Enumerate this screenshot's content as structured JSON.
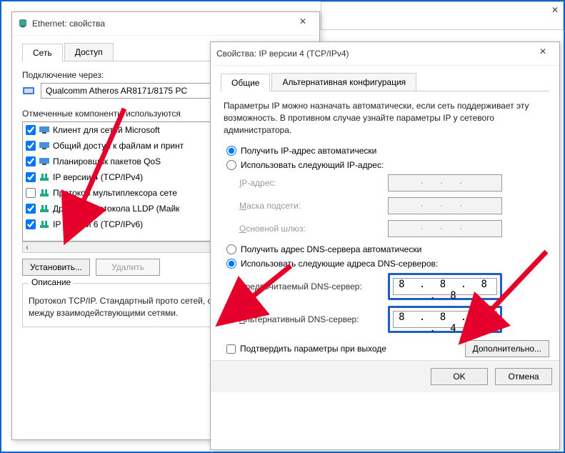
{
  "bg_parent": {
    "close": "✕"
  },
  "ethernet": {
    "title": "Ethernet: свойства",
    "close": "✕",
    "tabs": {
      "network": "Сеть",
      "access": "Доступ"
    },
    "connect_via_label": "Подключение через:",
    "adapter_name": "Qualcomm Atheros AR8171/8175 PC",
    "components_label": "Отмеченные компоненты используются",
    "components": [
      {
        "checked": true,
        "label": "Клиент для сетей Microsoft"
      },
      {
        "checked": true,
        "label": "Общий доступ к файлам и принт"
      },
      {
        "checked": true,
        "label": "Планировщик пакетов QoS"
      },
      {
        "checked": true,
        "label": "IP версии 4 (TCP/IPv4)"
      },
      {
        "checked": false,
        "label": "Протокол мультиплексора сете"
      },
      {
        "checked": true,
        "label": "Драйвер протокола LLDP (Майк"
      },
      {
        "checked": true,
        "label": "IP версии 6 (TCP/IPv6)"
      }
    ],
    "scroll_left": "‹",
    "install_btn": "Установить...",
    "remove_btn": "Удалить",
    "desc_title": "Описание",
    "desc_body": "Протокол TCP/IP. Стандартный прото сетей, обеспечивающий связь между взаимодействующими сетями."
  },
  "ipv4": {
    "title": "Свойства: IP версии 4 (TCP/IPv4)",
    "close": "✕",
    "tabs": {
      "general": "Общие",
      "alt": "Альтернативная конфигурация"
    },
    "paragraph": "Параметры IP можно назначать автоматически, если сеть поддерживает эту возможность. В противном случае узнайте параметры IP у сетевого администратора.",
    "ip_auto": "Получить IP-адрес автоматически",
    "ip_manual": "Использовать следующий IP-адрес:",
    "ip_addr_label": "IP-адрес:",
    "mask_label": "Маска подсети:",
    "gw_label": "Основной шлюз:",
    "dns_auto": "Получить адрес DNS-сервера автоматически",
    "dns_manual": "Использовать следующие адреса DNS-серверов:",
    "pref_dns_label": "Предпочитаемый DNS-сервер:",
    "alt_dns_label": "Альтернативный DNS-сервер:",
    "pref_dns_value": "8 . 8 . 8 . 8",
    "alt_dns_value": "8 . 8 . 4 . 4",
    "validate_label": "Подтвердить параметры при выходе",
    "advanced_btn": "Дополнительно...",
    "ok": "OK",
    "cancel": "Отмена",
    "ip_dots": ".   .   ."
  }
}
